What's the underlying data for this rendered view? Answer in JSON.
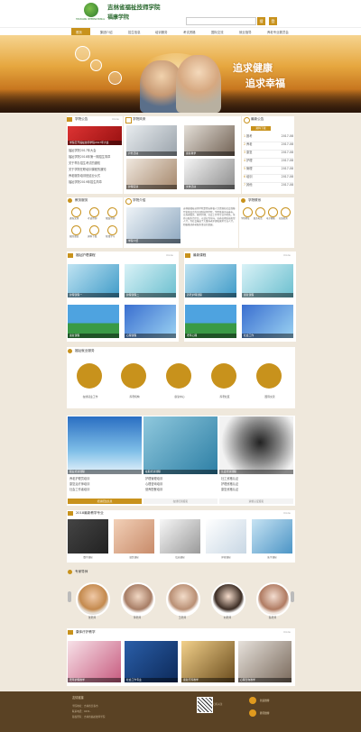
{
  "header": {
    "logo_cn": "吉林省福祉技师学院",
    "logo_en": "JILIN PROVINCE WELFARE TECHNICIAN COLLEGE",
    "logo_cn2": "福康学院",
    "logo_en2": "HOUKANG INTERNATIONAL",
    "search_placeholder": "",
    "search_btn": "搜",
    "user_btn": "登"
  },
  "nav": {
    "items": [
      "首页",
      "集团介绍",
      "招生信息",
      "培训服务",
      "考试资格",
      "国际交流",
      "就业指导",
      "养老专业委员会"
    ]
  },
  "banner": {
    "slogan1": "追求健康",
    "slogan2": "追求幸福"
  },
  "news": {
    "title": "学院公告",
    "more": "more",
    "headline": "学院召开福祉技师学院2017年大会",
    "items": [
      "福祉学院2017年大会",
      "福祉学院2018年第一期招生简章",
      "关于举办招生考试的通知",
      "关于学院在职培训课程的通知",
      "养老服务培训班结业仪式",
      "福祉学院2019年招生简章"
    ]
  },
  "gallery": {
    "title": "学院风采",
    "items": [
      "户外活动",
      "护理实训",
      "康复教学",
      "文体活动",
      "实训教学",
      "校园环境"
    ]
  },
  "downloads": {
    "title": "最新公告",
    "tab": "资料下载",
    "rows": [
      {
        "no": "1",
        "name": "报考",
        "date": "2017-08"
      },
      {
        "no": "2",
        "name": "养老",
        "date": "2017-08"
      },
      {
        "no": "3",
        "name": "康复",
        "date": "2017-08"
      },
      {
        "no": "4",
        "name": "护理",
        "date": "2017-08"
      },
      {
        "no": "5",
        "name": "管理",
        "date": "2017-08"
      },
      {
        "no": "6",
        "name": "培训",
        "date": "2017-08"
      },
      {
        "no": "7",
        "name": "其他",
        "date": "2017-08"
      }
    ]
  },
  "services": {
    "title": "教务服务",
    "items": [
      "课程安排",
      "考试查询",
      "成绩查询",
      "我的课表",
      "资料下载",
      "在线学习"
    ]
  },
  "intro": {
    "title": "学院介绍",
    "cap1": "福祉学院",
    "cap2": "学院介绍",
    "body": "吉林省福祉技师学院是经吉林省人力资源和社会保障厅批准设立的全日制技师学院，学院坐落于长春市，以养老服务、康复护理、社会工作等专业为特色，坚持以服务为宗旨，以就业为导向，培养高素质技能型人才，为社会输送了大量养老护理和康复专业人才，积极推动养老服务事业的发展。"
  },
  "contact": {
    "title": "学院联系",
    "items": [
      "学院地址",
      "联系电话",
      "电子邮箱",
      "在线咨询"
    ]
  },
  "courses1": {
    "title": "福祉护理课程",
    "more": "more",
    "items": [
      "护理课程一",
      "护理课程二",
      "康复课程",
      "心理课程"
    ]
  },
  "courses2": {
    "title": "最新课程",
    "more": "more",
    "items": [
      "养老护理课程",
      "康复课程",
      "老年心理",
      "社会工作"
    ]
  },
  "features": {
    "title": "福祉就业服务",
    "items": [
      "在线就业工作",
      "养老机构",
      "康复中心",
      "养老社区",
      "国际交流"
    ]
  },
  "training": {
    "cols": [
      {
        "title": "职业培训课程",
        "items": [
          "养老护理员培训",
          "康复治疗师培训",
          "社会工作者培训"
        ]
      },
      {
        "title": "在职培训课程",
        "items": [
          "护理管理培训",
          "心理咨询培训",
          "营养配餐培训"
        ]
      },
      {
        "title": "认证培训课程",
        "items": [
          "社工资格认证",
          "护理资格认证",
          "康复资格认证"
        ]
      }
    ],
    "tabs": [
      "培训招生信息",
      "在线培训报名",
      "资格认证报名"
    ]
  },
  "teaching": {
    "title": "2018最新教学专业",
    "more": "more",
    "items": [
      "数学课程",
      "语文课程",
      "绘画课程",
      "护理课程",
      "医学课程"
    ]
  },
  "teachers": {
    "title": "专家导师",
    "items": [
      "张老师",
      "李老师",
      "王老师",
      "刘老师",
      "陈老师"
    ]
  },
  "study": {
    "title": "康体疗护教学",
    "more": "more",
    "items": [
      "老年护理教学",
      "社会工作专业",
      "康复疗养教学",
      "心理咨询教学"
    ]
  },
  "footer": {
    "title": "友情链接",
    "lines": [
      "学院地址：吉林省长春市",
      "联系电话：0431-",
      "版权所有：吉林省福祉技师学院"
    ],
    "qr_label": "扫码关注",
    "links": [
      "新浪微博",
      "腾讯微博"
    ]
  },
  "colors": {
    "gold": "#c8921c",
    "cream": "#efe8dc",
    "footer": "#5a4224"
  }
}
